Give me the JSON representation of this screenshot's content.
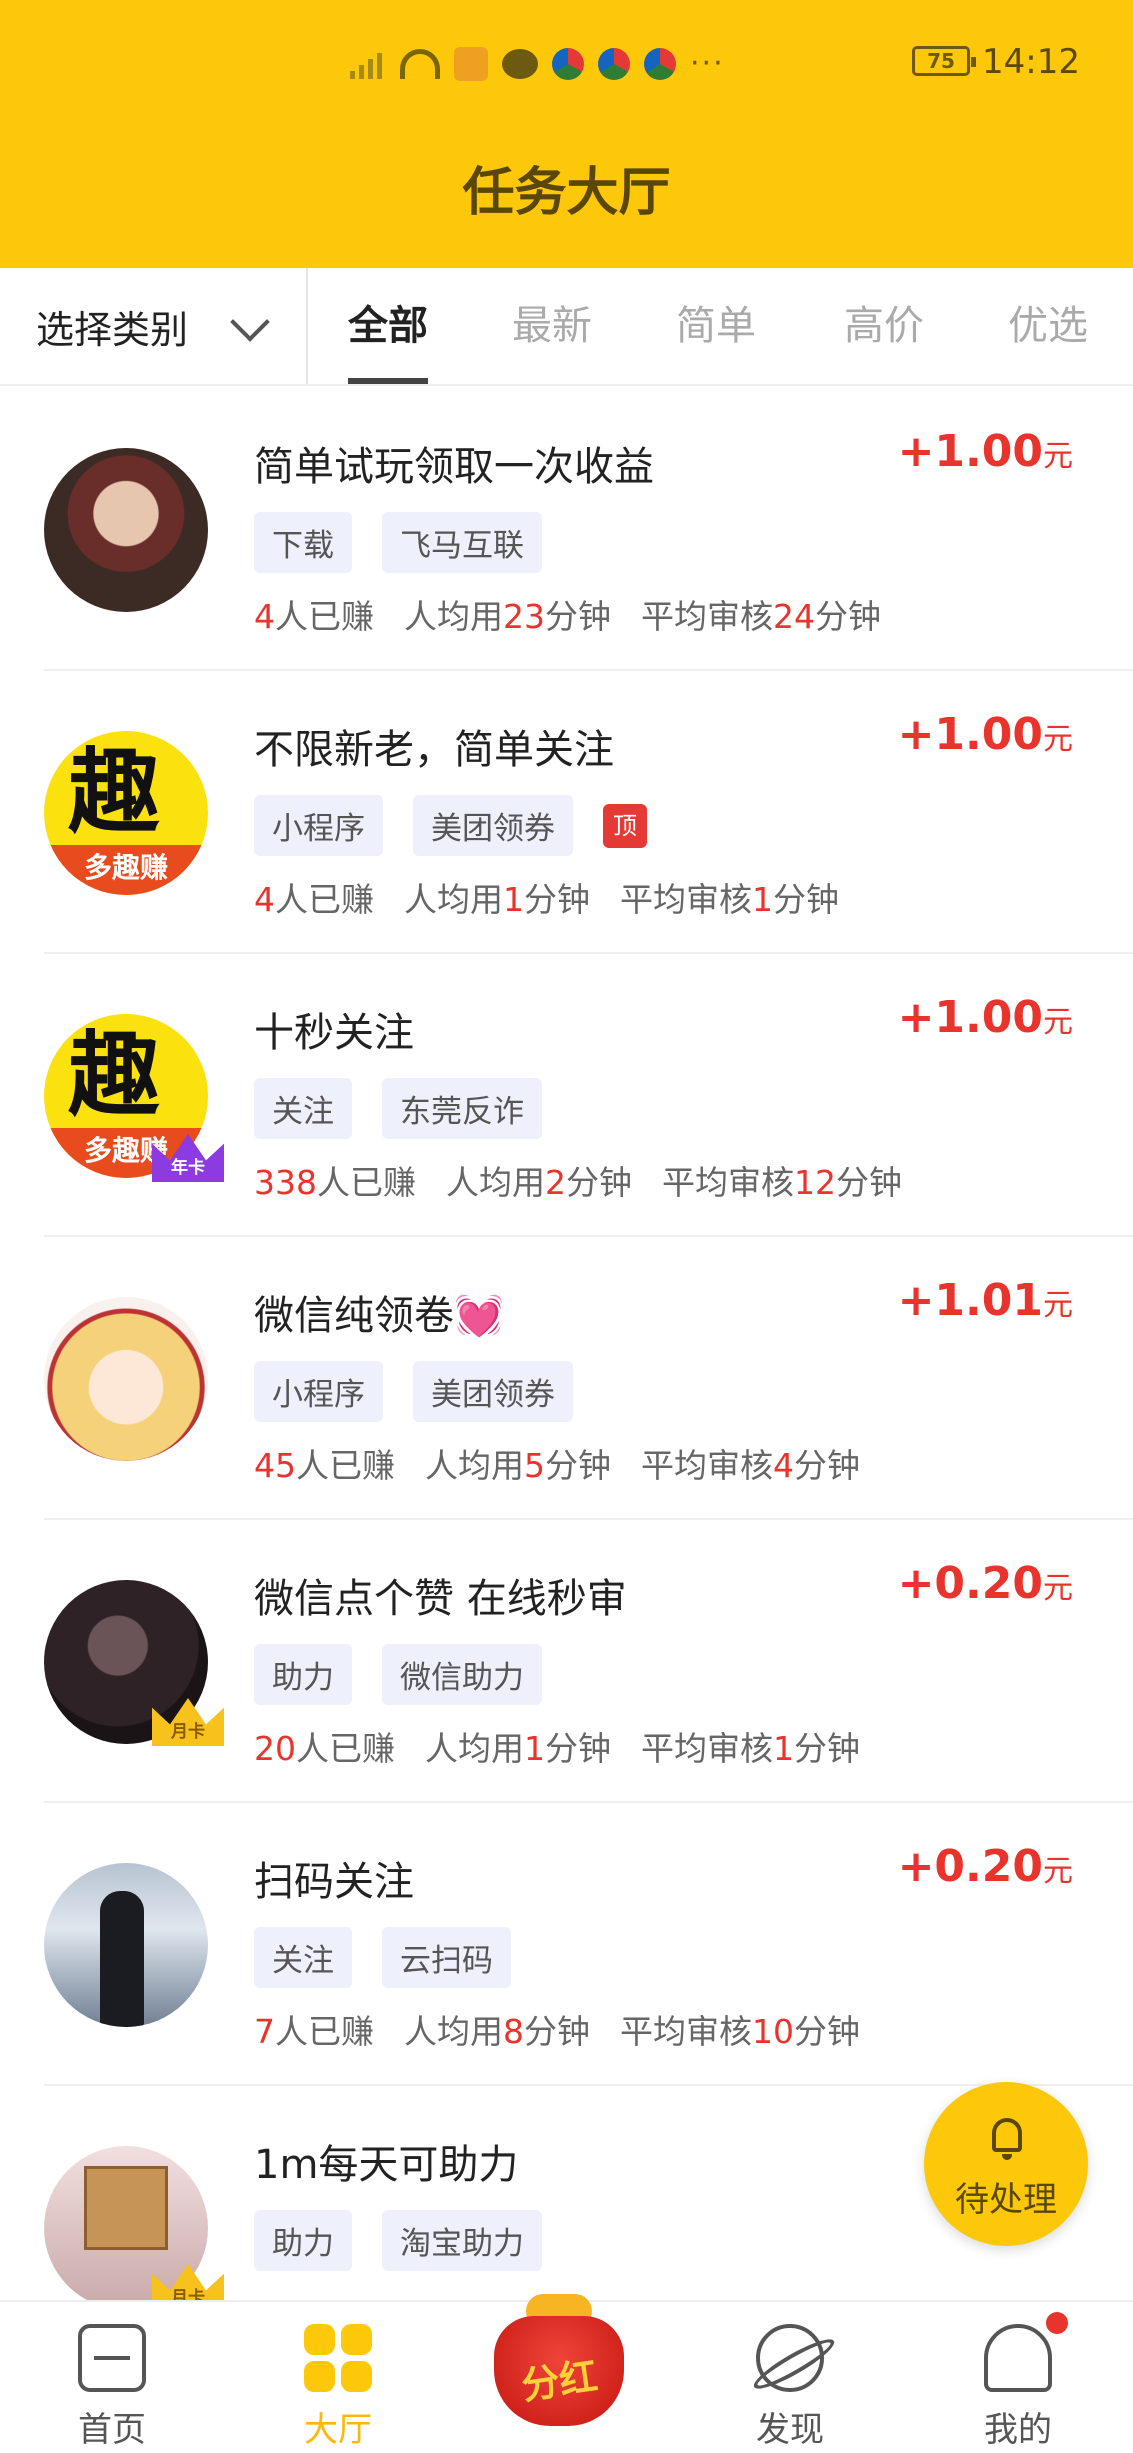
{
  "status_bar": {
    "battery": "75",
    "time": "14:12"
  },
  "header": {
    "title": "任务大厅"
  },
  "filter": {
    "category_label": "选择类别",
    "tabs": [
      "全部",
      "最新",
      "简单",
      "高价",
      "优选"
    ],
    "active_tab": "全部"
  },
  "tasks": [
    {
      "title": "简单试玩领取一次收益",
      "reward": "+1.00",
      "unit": "元",
      "tags": [
        "下载",
        "飞马互联"
      ],
      "earned_count": "4",
      "earned_label": "人已赚",
      "avg_label": "人均用",
      "avg_minutes": "23",
      "review_label": "平均审核",
      "review_minutes": "24",
      "minutes_suffix": "分钟"
    },
    {
      "title": "不限新老，简单关注",
      "reward": "+1.00",
      "unit": "元",
      "tags": [
        "小程序",
        "美团领券"
      ],
      "top_badge": "顶",
      "avatar_text": "多趣赚",
      "avatar_glyph": "趣",
      "earned_count": "4",
      "earned_label": "人已赚",
      "avg_label": "人均用",
      "avg_minutes": "1",
      "review_label": "平均审核",
      "review_minutes": "1",
      "minutes_suffix": "分钟"
    },
    {
      "title": "十秒关注",
      "reward": "+1.00",
      "unit": "元",
      "tags": [
        "关注",
        "东莞反诈"
      ],
      "avatar_text": "多趣赚",
      "avatar_glyph": "趣",
      "badge": "年卡",
      "earned_count": "338",
      "earned_label": "人已赚",
      "avg_label": "人均用",
      "avg_minutes": "2",
      "review_label": "平均审核",
      "review_minutes": "12",
      "minutes_suffix": "分钟"
    },
    {
      "title": "微信纯领卷💓",
      "reward": "+1.01",
      "unit": "元",
      "tags": [
        "小程序",
        "美团领券"
      ],
      "earned_count": "45",
      "earned_label": "人已赚",
      "avg_label": "人均用",
      "avg_minutes": "5",
      "review_label": "平均审核",
      "review_minutes": "4",
      "minutes_suffix": "分钟"
    },
    {
      "title": "微信点个赞 在线秒审",
      "reward": "+0.20",
      "unit": "元",
      "tags": [
        "助力",
        "微信助力"
      ],
      "badge": "月卡",
      "earned_count": "20",
      "earned_label": "人已赚",
      "avg_label": "人均用",
      "avg_minutes": "1",
      "review_label": "平均审核",
      "review_minutes": "1",
      "minutes_suffix": "分钟"
    },
    {
      "title": "扫码关注",
      "reward": "+0.20",
      "unit": "元",
      "tags": [
        "关注",
        "云扫码"
      ],
      "earned_count": "7",
      "earned_label": "人已赚",
      "avg_label": "人均用",
      "avg_minutes": "8",
      "review_label": "平均审核",
      "review_minutes": "10",
      "minutes_suffix": "分钟"
    },
    {
      "title": "1m每天可助力",
      "tags": [
        "助力",
        "淘宝助力"
      ],
      "badge": "月卡"
    }
  ],
  "fab": {
    "label": "待处理"
  },
  "bottom_nav": {
    "items": [
      "首页",
      "大厅",
      "发现",
      "我的"
    ],
    "center_label": "分红",
    "active": "大厅"
  },
  "colors": {
    "brand_yellow": "#fdc80a",
    "reward_red": "#e8342c",
    "tag_bg": "#eef0fb"
  }
}
